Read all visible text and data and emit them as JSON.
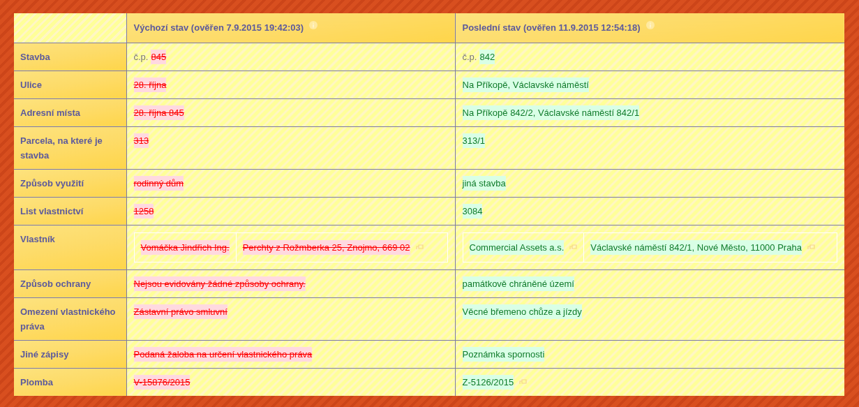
{
  "columns": [
    {
      "title": "Výchozí stav (ověřen 7.9.2015 19:42:03)",
      "info": true
    },
    {
      "title": "Poslední stav (ověřen 11.9.2015 12:54:18)",
      "info": true
    }
  ],
  "rows": [
    {
      "label": "Stavba",
      "kind": "plain",
      "old": {
        "removed": true,
        "prefix": "č.p.",
        "items": [
          {
            "text": "845",
            "link": false
          }
        ]
      },
      "new": {
        "removed": false,
        "prefix": "č.p.",
        "items": [
          {
            "text": "842",
            "link": false
          }
        ]
      }
    },
    {
      "label": "Ulice",
      "kind": "plain",
      "old": {
        "removed": true,
        "items": [
          {
            "text": "28. října",
            "link": false
          }
        ]
      },
      "new": {
        "removed": false,
        "items": [
          {
            "text": "Na Příkopě, Václavské náměstí",
            "link": false
          }
        ]
      }
    },
    {
      "label": "Adresní místa",
      "kind": "plain",
      "old": {
        "removed": true,
        "items": [
          {
            "text": "28. října 845",
            "link": false
          }
        ]
      },
      "new": {
        "removed": false,
        "items": [
          {
            "text": "Na Příkopě 842/2, Václavské náměstí 842/1",
            "link": false
          }
        ]
      }
    },
    {
      "label": "Parcela, na které je stavba",
      "kind": "plain",
      "old": {
        "removed": true,
        "items": [
          {
            "text": "313",
            "link": false
          }
        ]
      },
      "new": {
        "removed": false,
        "items": [
          {
            "text": "313/1",
            "link": false
          }
        ]
      }
    },
    {
      "label": "Způsob využití",
      "kind": "plain",
      "old": {
        "removed": true,
        "items": [
          {
            "text": "rodinný dům",
            "link": false
          }
        ]
      },
      "new": {
        "removed": false,
        "items": [
          {
            "text": "jiná stavba",
            "link": false
          }
        ]
      }
    },
    {
      "label": "List vlastnictví",
      "kind": "plain",
      "old": {
        "removed": true,
        "items": [
          {
            "text": "1258",
            "link": false
          }
        ]
      },
      "new": {
        "removed": false,
        "items": [
          {
            "text": "3084",
            "link": false
          }
        ]
      }
    },
    {
      "label": "Vlastník",
      "kind": "boxed",
      "old": {
        "removed": true,
        "items": [
          {
            "text": "Vomáčka Jindřich Ing.",
            "link": false
          },
          {
            "text": "Perchty z Rožmberka 25, Znojmo, 669 02",
            "link": true
          }
        ]
      },
      "new": {
        "removed": false,
        "items": [
          {
            "text": "Commercial Assets a.s.",
            "link": true
          },
          {
            "text": "Václavské náměstí 842/1, Nové Město, 11000 Praha",
            "link": true
          }
        ]
      }
    },
    {
      "label": "Způsob ochrany",
      "kind": "plain",
      "old": {
        "removed": true,
        "items": [
          {
            "text": "Nejsou evidovány žádné způsoby ochrany.",
            "link": false
          }
        ]
      },
      "new": {
        "removed": false,
        "items": [
          {
            "text": "památkově chráněné území",
            "link": false
          }
        ]
      }
    },
    {
      "label": "Omezení vlastnického práva",
      "kind": "plain",
      "old": {
        "removed": true,
        "items": [
          {
            "text": "Zástavní právo smluvní",
            "link": false
          }
        ]
      },
      "new": {
        "removed": false,
        "items": [
          {
            "text": "Věcné břemeno chůze a jízdy",
            "link": false
          }
        ]
      }
    },
    {
      "label": "Jiné zápisy",
      "kind": "plain",
      "old": {
        "removed": true,
        "items": [
          {
            "text": "Podaná žaloba na určení vlastnického práva",
            "link": false
          }
        ]
      },
      "new": {
        "removed": false,
        "items": [
          {
            "text": "Poznámka spornosti",
            "link": false
          }
        ]
      }
    },
    {
      "label": "Plomba",
      "kind": "plain",
      "old": {
        "removed": true,
        "items": [
          {
            "text": "V-15876/2015",
            "link": false
          }
        ]
      },
      "new": {
        "removed": false,
        "items": [
          {
            "text": "Z-5126/2015",
            "link": true
          }
        ]
      }
    }
  ]
}
